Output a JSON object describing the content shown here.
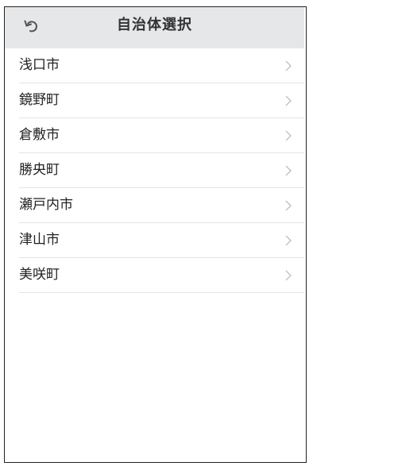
{
  "header": {
    "title": "自治体選択",
    "back_icon": "undo-arrow-icon"
  },
  "municipalities": [
    {
      "label": "浅口市"
    },
    {
      "label": "鏡野町"
    },
    {
      "label": "倉敷市"
    },
    {
      "label": "勝央町"
    },
    {
      "label": "瀬戸内市"
    },
    {
      "label": "津山市"
    },
    {
      "label": "美咲町"
    }
  ],
  "colors": {
    "header_bg": "#e6e7e8",
    "divider": "#e3e3e3",
    "chevron": "#b5b5b5",
    "text": "#222222"
  }
}
